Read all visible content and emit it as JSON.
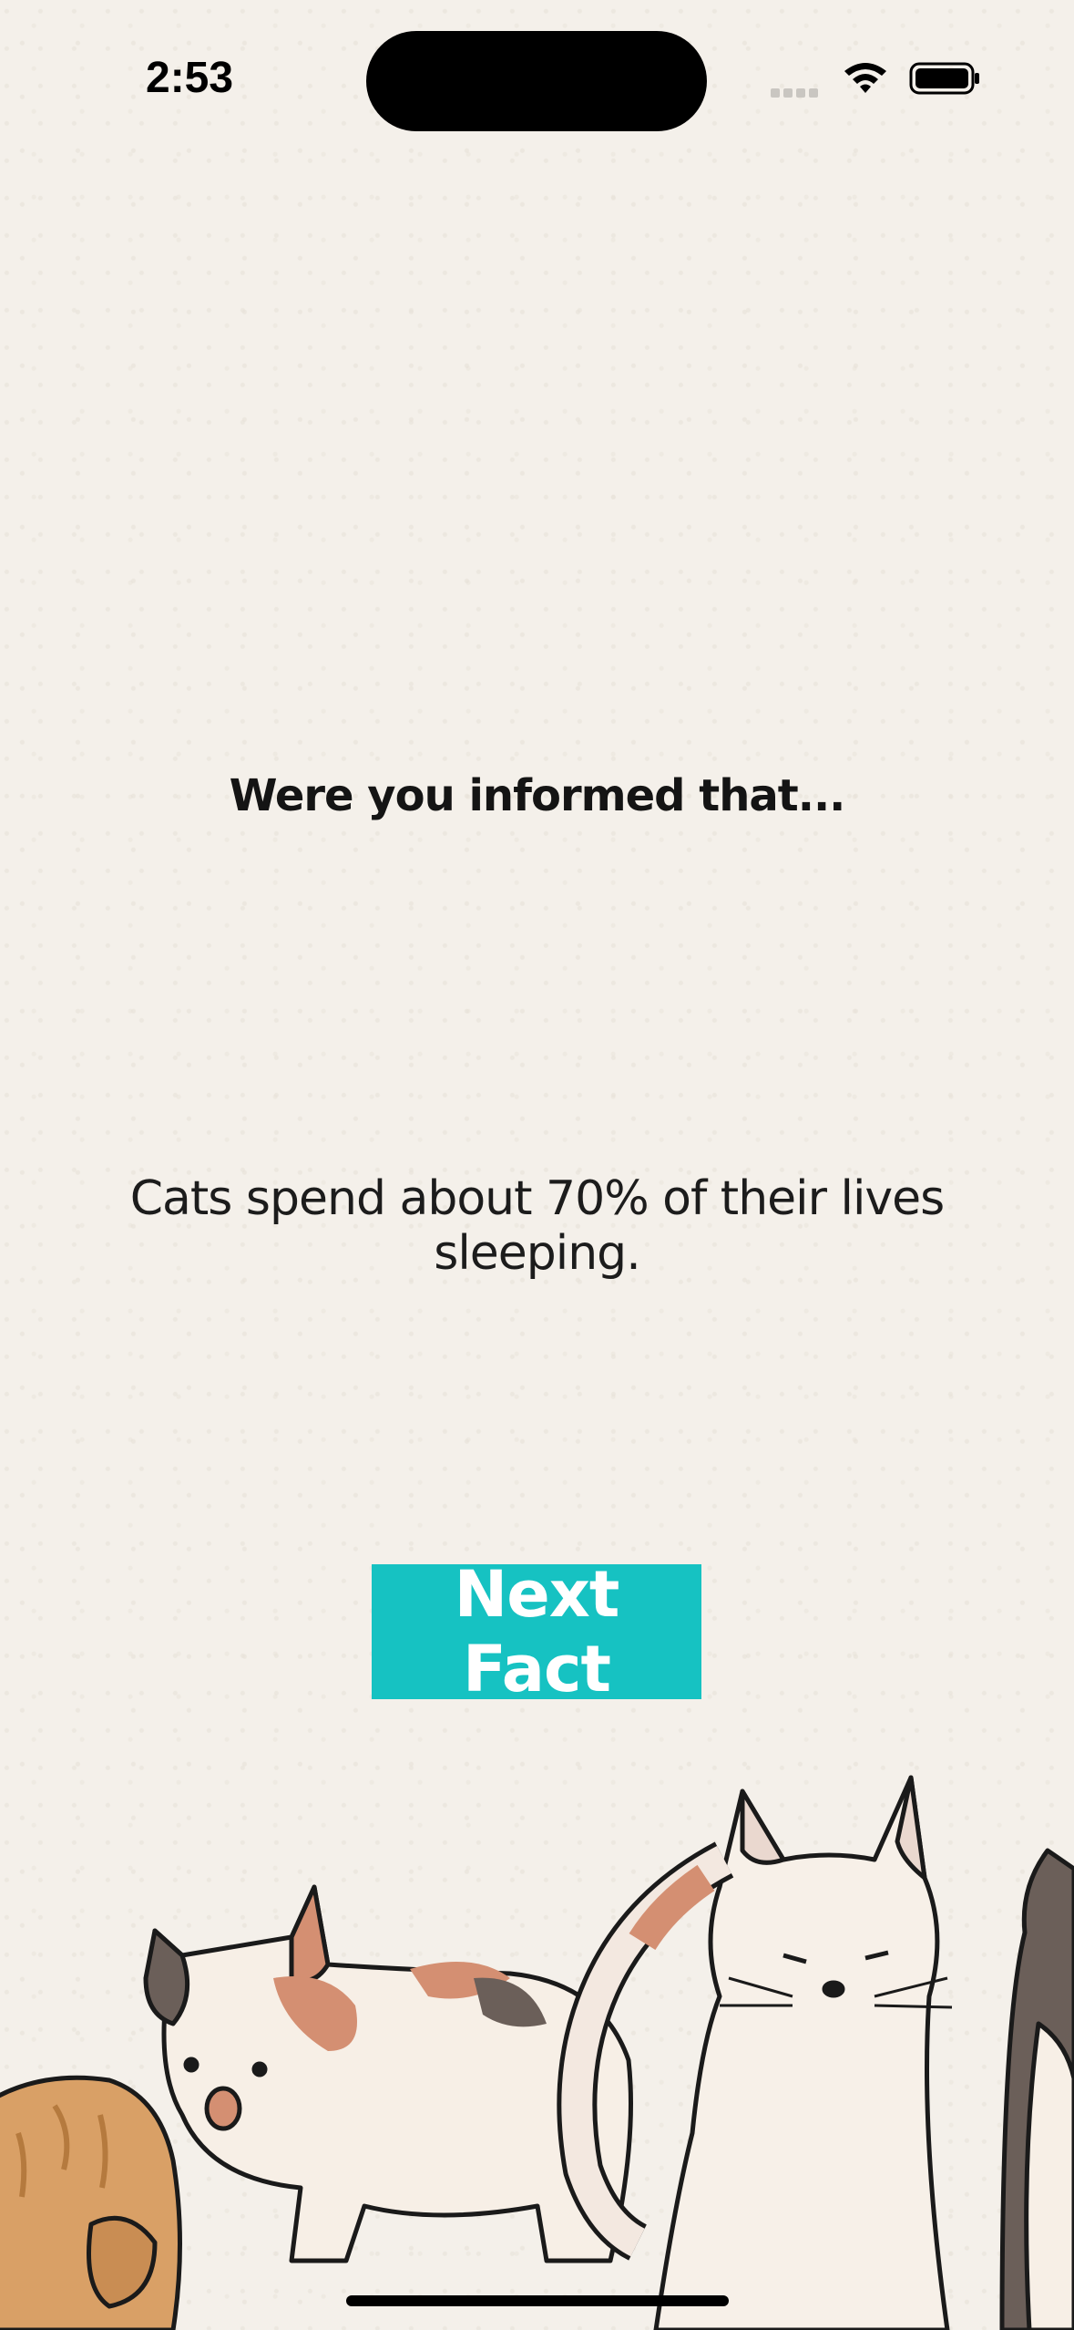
{
  "status_bar": {
    "time": "2:53",
    "icons": [
      "signal-icon",
      "wifi-icon",
      "battery-icon"
    ]
  },
  "main": {
    "heading": "Were you informed that...",
    "fact": "Cats spend about 70% of their lives sleeping.",
    "next_button_label": "Next Fact"
  },
  "colors": {
    "background": "#f4f0ea",
    "button": "#16c2c2",
    "button_text": "#ffffff"
  },
  "illustration": "cats-illustration"
}
